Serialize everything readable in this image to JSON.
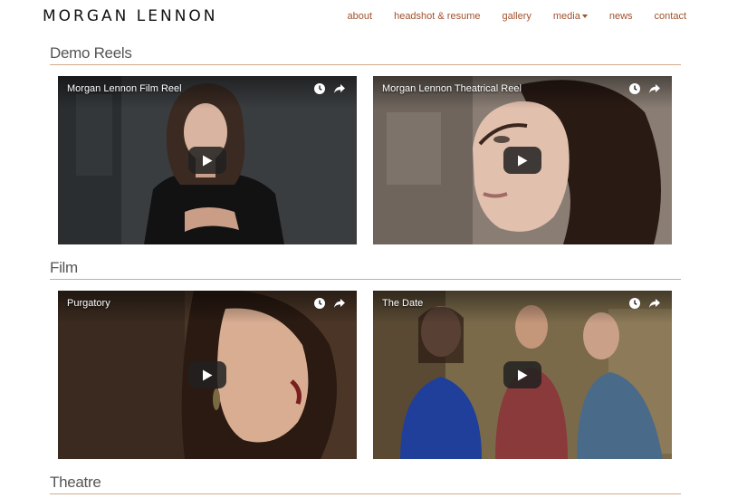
{
  "site": {
    "logo": "MORGAN LENNON"
  },
  "nav": {
    "items": [
      {
        "label": "about"
      },
      {
        "label": "headshot & resume"
      },
      {
        "label": "gallery"
      },
      {
        "label": "media"
      },
      {
        "label": "news"
      },
      {
        "label": "contact"
      }
    ],
    "accent": "#a0522d"
  },
  "sections": [
    {
      "title": "Demo Reels",
      "videos": [
        {
          "title": "Morgan Lennon Film Reel"
        },
        {
          "title": "Morgan Lennon Theatrical Reel"
        }
      ]
    },
    {
      "title": "Film",
      "videos": [
        {
          "title": "Purgatory"
        },
        {
          "title": "The Date"
        }
      ]
    },
    {
      "title": "Theatre",
      "videos": []
    }
  ],
  "icons": {
    "watch_later": "clock-icon",
    "share": "share-icon",
    "play": "play-icon",
    "dropdown": "chevron-down-icon"
  },
  "colors": {
    "rule": "#d4aa8c",
    "section_title": "#555555"
  }
}
